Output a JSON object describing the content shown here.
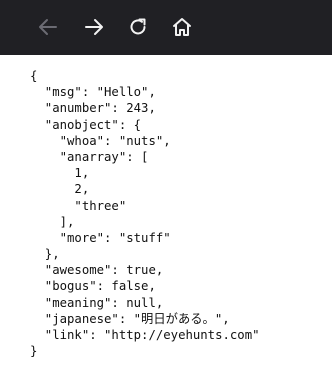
{
  "toolbar": {
    "icons": [
      "back-arrow-icon",
      "forward-arrow-icon",
      "reload-icon",
      "home-icon"
    ],
    "colors": {
      "background": "#202024",
      "back_disabled": "#6b6b73",
      "active_icon": "#f2f2f2"
    }
  },
  "content": {
    "lines": [
      "{",
      "  \"msg\": \"Hello\",",
      "  \"anumber\": 243,",
      "  \"anobject\": {",
      "    \"whoa\": \"nuts\",",
      "    \"anarray\": [",
      "      1,",
      "      2,",
      "      \"three\"",
      "    ],",
      "    \"more\": \"stuff\"",
      "  },",
      "  \"awesome\": true,",
      "  \"bogus\": false,",
      "  \"meaning\": null,",
      "  \"japanese\": \"明日がある。\",",
      "  \"link\": \"http://eyehunts.com\"",
      "}"
    ]
  }
}
